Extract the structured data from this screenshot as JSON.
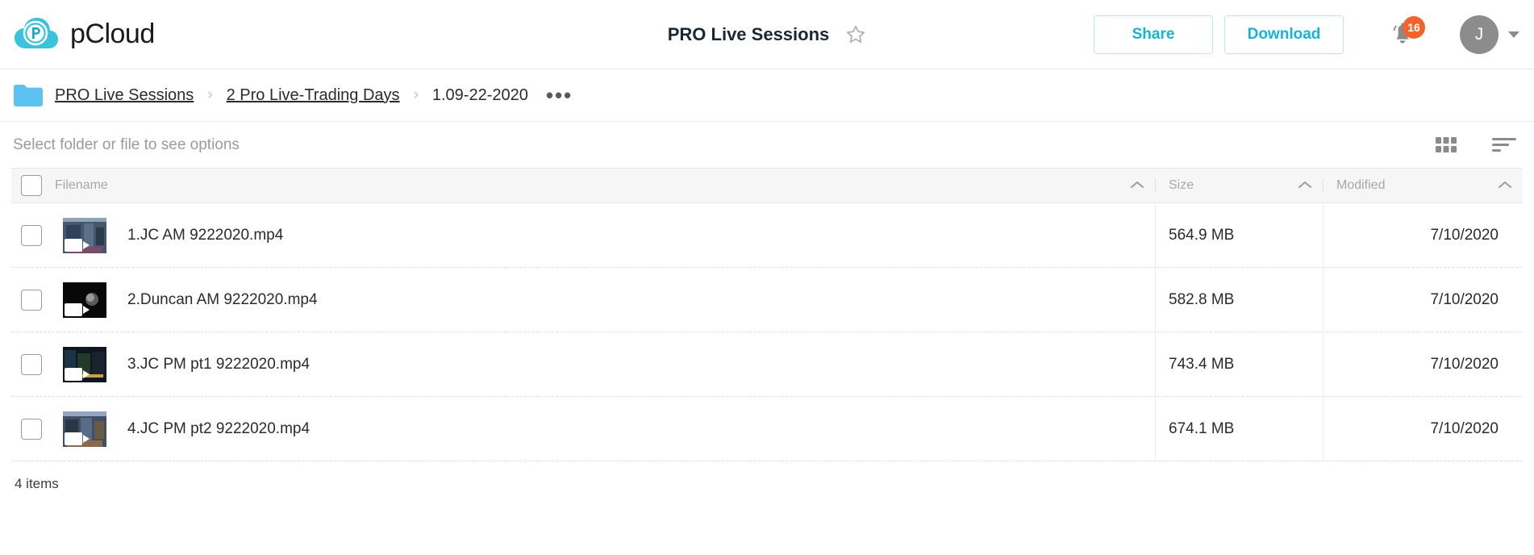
{
  "brand": {
    "name": "pCloud",
    "logo_icon": "pcloud-cloud-logo",
    "accent_color": "#17b3d4",
    "logo_color": "#3bc3dd"
  },
  "header": {
    "title": "PRO Live Sessions",
    "favorite_icon": "star-outline-icon",
    "share_label": "Share",
    "download_label": "Download",
    "notifications": {
      "icon": "bell-icon",
      "count": "16",
      "badge_color": "#f4642a"
    },
    "account": {
      "avatar_initial": "J",
      "avatar_color": "#8c8c8c",
      "caret_icon": "chevron-down-icon"
    }
  },
  "breadcrumb": {
    "folder_icon": "folder-icon",
    "separator": "›",
    "items": [
      {
        "label": "PRO Live Sessions",
        "is_link": true
      },
      {
        "label": "2 Pro Live-Trading Days",
        "is_link": true
      },
      {
        "label": "1.09-22-2020",
        "is_link": false
      }
    ],
    "overflow_label": "•••"
  },
  "options_bar": {
    "hint": "Select folder or file to see options",
    "grid_view_icon": "grid-view-icon",
    "list_view_icon": "list-view-icon"
  },
  "table": {
    "select_all_checkbox": "select-all-checkbox",
    "columns": [
      {
        "key": "filename",
        "label": "Filename",
        "sort_icon": "chevron-up-icon"
      },
      {
        "key": "size",
        "label": "Size",
        "sort_icon": "chevron-up-icon"
      },
      {
        "key": "modified",
        "label": "Modified",
        "sort_icon": "chevron-up-icon"
      }
    ],
    "rows": [
      {
        "filename": "1.JC AM 9222020.mp4",
        "size": "564.9 MB",
        "modified": "7/10/2020",
        "thumb_colors": [
          "#5a6b80",
          "#2f3a48",
          "#7b6a59"
        ],
        "selected": false
      },
      {
        "filename": "2.Duncan AM 9222020.mp4",
        "size": "582.8 MB",
        "modified": "7/10/2020",
        "thumb_colors": [
          "#0a0a0a",
          "#141414",
          "#2a2a2a"
        ],
        "selected": false
      },
      {
        "filename": "3.JC PM pt1 9222020.mp4",
        "size": "743.4 MB",
        "modified": "7/10/2020",
        "thumb_colors": [
          "#1c2430",
          "#11304a",
          "#2b3b2b"
        ],
        "selected": false
      },
      {
        "filename": "4.JC PM pt2 9222020.mp4",
        "size": "674.1 MB",
        "modified": "7/10/2020",
        "thumb_colors": [
          "#4a5a70",
          "#263244",
          "#6b5a44"
        ],
        "selected": false
      }
    ]
  },
  "footer": {
    "item_count": "4 items"
  }
}
